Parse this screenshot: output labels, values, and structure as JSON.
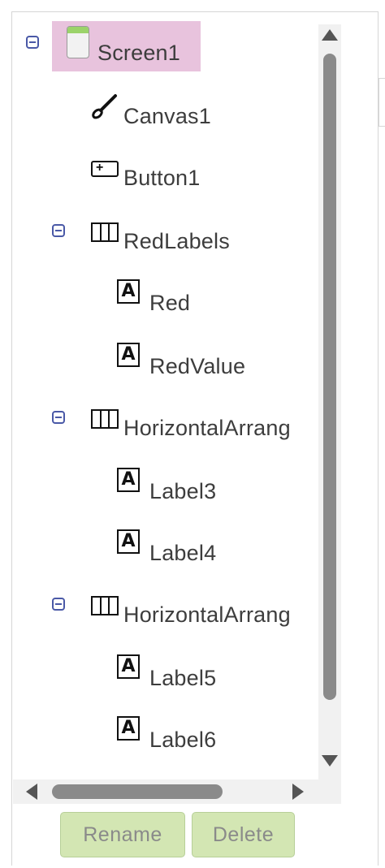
{
  "tree": {
    "nodes": [
      {
        "label": "Screen1",
        "icon": "screen-icon",
        "depth": 0,
        "collapsible": true,
        "selected": true
      },
      {
        "label": "Canvas1",
        "icon": "paintbrush-icon",
        "depth": 1,
        "collapsible": false
      },
      {
        "label": "Button1",
        "icon": "button-icon",
        "depth": 1,
        "collapsible": false
      },
      {
        "label": "RedLabels",
        "icon": "horizontal-arrangement-icon",
        "depth": 1,
        "collapsible": true
      },
      {
        "label": "Red",
        "icon": "label-icon",
        "depth": 2,
        "collapsible": false
      },
      {
        "label": "RedValue",
        "icon": "label-icon",
        "depth": 2,
        "collapsible": false
      },
      {
        "label": "HorizontalArrang",
        "icon": "horizontal-arrangement-icon",
        "depth": 1,
        "collapsible": true
      },
      {
        "label": "Label3",
        "icon": "label-icon",
        "depth": 2,
        "collapsible": false
      },
      {
        "label": "Label4",
        "icon": "label-icon",
        "depth": 2,
        "collapsible": false
      },
      {
        "label": "HorizontalArrang",
        "icon": "horizontal-arrangement-icon",
        "depth": 1,
        "collapsible": true
      },
      {
        "label": "Label5",
        "icon": "label-icon",
        "depth": 2,
        "collapsible": false
      },
      {
        "label": "Label6",
        "icon": "label-icon",
        "depth": 2,
        "collapsible": false
      }
    ],
    "label_icon_glyph": "A",
    "button_icon_glyph": "+"
  },
  "buttons": {
    "rename": "Rename",
    "delete": "Delete"
  },
  "colors": {
    "selection": "#e8c3dd",
    "toggle": "#4a59a7",
    "button_bg": "#d3e6b3"
  }
}
